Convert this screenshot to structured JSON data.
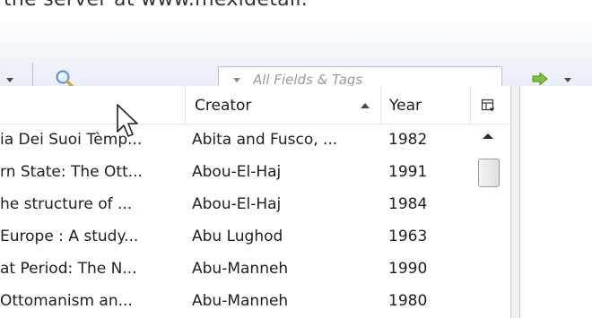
{
  "banner": {
    "text": "the server at www.mexidetail."
  },
  "toolbar": {
    "search_placeholder": "All Fields & Tags",
    "search_value": ""
  },
  "icons": {
    "search": "magnifier-icon",
    "go": "green-arrow-icon",
    "column_picker": "column-picker-icon",
    "cursor": "mouse-pointer-icon"
  },
  "columns": {
    "title": "",
    "creator": "Creator",
    "year": "Year",
    "sort_column": "Creator",
    "sort_direction": "ascending"
  },
  "rows": [
    {
      "title": "ia Dei Suoi Tèmp...",
      "creator": "Abita and Fusco, ...",
      "year": "1982"
    },
    {
      "title": "rn State: The Ott...",
      "creator": "Abou-El-Haj",
      "year": "1991"
    },
    {
      "title": "he structure of ...",
      "creator": "Abou-El-Haj",
      "year": "1984"
    },
    {
      "title": "Europe : A study...",
      "creator": "Abu Lughod",
      "year": "1963"
    },
    {
      "title": "at Period: The N...",
      "creator": "Abu-Manneh",
      "year": "1990"
    },
    {
      "title": "Ottomanism an...",
      "creator": "Abu-Manneh",
      "year": "1980"
    }
  ],
  "colors": {
    "toolbar_top": "#fcfdfe",
    "toolbar_bottom": "#e6ebf3",
    "go_arrow": "#7cc43a",
    "text": "#1e1e1e"
  }
}
